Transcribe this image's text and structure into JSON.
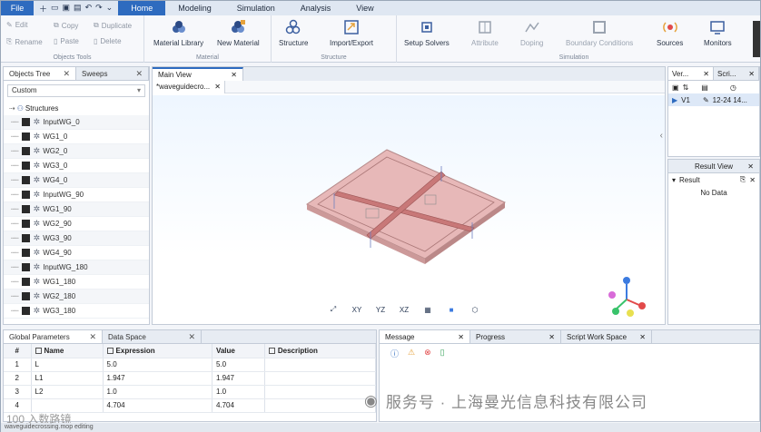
{
  "menubar": {
    "file": "File",
    "quick_access_icons": [
      "new-icon",
      "open-icon",
      "save-icon",
      "saveas-icon",
      "undo-icon",
      "redo-icon",
      "dropdown-icon"
    ],
    "items": [
      "Home",
      "Modeling",
      "Simulation",
      "Analysis",
      "View"
    ],
    "active": "Home"
  },
  "ribbon": {
    "objects_tools": {
      "label": "Objects Tools",
      "edit": "Edit",
      "copy": "Copy",
      "duplicate": "Duplicate",
      "rename": "Rename",
      "paste": "Paste",
      "delete": "Delete"
    },
    "material": {
      "label": "Material",
      "library": "Material Library",
      "new": "New Material"
    },
    "structure": {
      "label": "Structure",
      "structure": "Structure",
      "import_export": "Import/Export"
    },
    "simulation": {
      "label": "Simulation",
      "setup_solvers": "Setup Solvers",
      "attribute": "Attribute",
      "doping": "Doping",
      "boundary": "Boundary Conditions",
      "sources": "Sources",
      "monitors": "Monitors"
    }
  },
  "left_panel": {
    "tabs": [
      "Objects Tree",
      "Sweeps"
    ],
    "filter": "Custom",
    "root": "Structures",
    "items": [
      "InputWG_0",
      "WG1_0",
      "WG2_0",
      "WG3_0",
      "WG4_0",
      "InputWG_90",
      "WG1_90",
      "WG2_90",
      "WG3_90",
      "WG4_90",
      "InputWG_180",
      "WG1_180",
      "WG2_180",
      "WG3_180"
    ]
  },
  "main_view": {
    "tab": "Main View",
    "subtab": "*waveguidecro...",
    "toolbar": [
      "axis",
      "XY",
      "YZ",
      "XZ",
      "grid",
      "solid",
      "mesh"
    ],
    "toolbar_labels": {
      "xy": "XY",
      "yz": "YZ",
      "xz": "XZ"
    },
    "axis_colors": {
      "x": "#e24a4a",
      "y": "#39c36b",
      "z": "#3c7be0",
      "extra": "#d86bd8"
    }
  },
  "right_panel": {
    "tabs": [
      "Ver...",
      "Scri..."
    ],
    "version_row": {
      "name": "V1",
      "date": "12-24 14..."
    },
    "result_view": {
      "title": "Result View",
      "column": "Result",
      "empty": "No Data"
    }
  },
  "global_parameters": {
    "tabs": [
      "Global Parameters",
      "Data Space"
    ],
    "columns": [
      "#",
      "Name",
      "Expression",
      "Value",
      "Description"
    ],
    "rows": [
      {
        "n": "1",
        "name": "L",
        "expr": "5.0",
        "value": "5.0",
        "desc": ""
      },
      {
        "n": "2",
        "name": "L1",
        "expr": "1.947",
        "value": "1.947",
        "desc": ""
      },
      {
        "n": "3",
        "name": "L2",
        "expr": "1.0",
        "value": "1.0",
        "desc": ""
      },
      {
        "n": "4",
        "name": "",
        "expr": "4.704",
        "value": "4.704",
        "desc": ""
      }
    ]
  },
  "bottom_right": {
    "tabs": [
      "Message",
      "Progress",
      "Script Work Space"
    ]
  },
  "statusbar": {
    "text": "waveguidecrossing.mop editing"
  },
  "watermark": {
    "text": "服务号 · 上海曼光信息科技有限公司",
    "left": "100 入数路镜"
  }
}
